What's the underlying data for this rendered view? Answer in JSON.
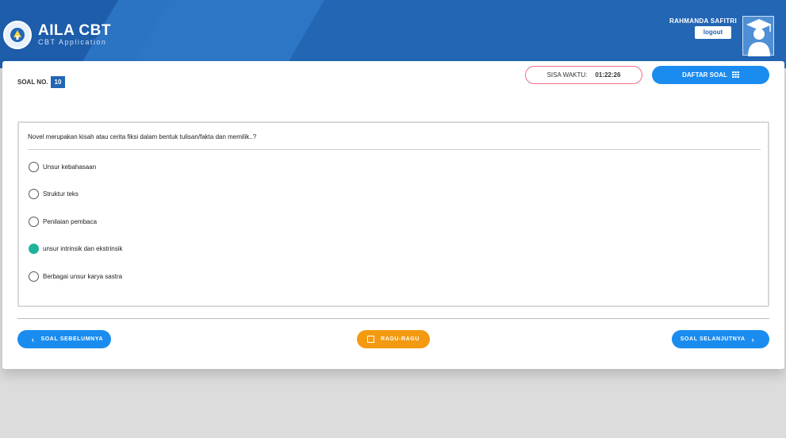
{
  "header": {
    "app_title": "AILA CBT",
    "app_subtitle": "CBT Application",
    "user_name": "RAHMANDA SAFITRI",
    "logout_label": "logout",
    "colors": {
      "header_bg": "#2366b3",
      "accent": "#1a8cf0"
    }
  },
  "exam": {
    "soal_label": "SOAL NO.",
    "soal_number": "10",
    "timer_label": "SISA WAKTU:",
    "timer_value": "01:22:26",
    "daftar_label": "DAFTAR SOAL",
    "question": "Novel merupakan kisah atau cerita fiksi dalam bentuk tulisan/fakta dan memilik..?",
    "options": [
      {
        "label": "Unsur kebahasaan",
        "selected": false
      },
      {
        "label": "Struktur teks",
        "selected": false
      },
      {
        "label": "Penilaian pembaca",
        "selected": false
      },
      {
        "label": "unsur intrinsik dan ekstrinsik",
        "selected": true
      },
      {
        "label": "Berbagai unsur karya sastra",
        "selected": false
      }
    ]
  },
  "nav": {
    "prev_label": "SOAL SEBELUMNYA",
    "ragu_label": "RAGU-RAGU",
    "next_label": "SOAL SELANJUTNYA"
  }
}
